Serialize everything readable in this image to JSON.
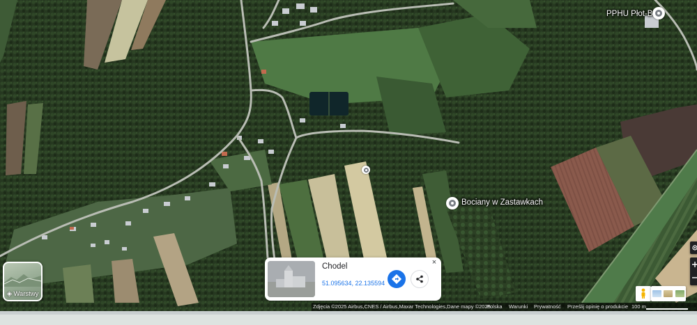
{
  "map": {
    "labels": {
      "business": "PPHU Płot-Bet",
      "poi": "Bociany w Zastawkach"
    }
  },
  "layers_button": {
    "label": "Warstwy",
    "icon": "layers-icon"
  },
  "info_card": {
    "title": "Chodel",
    "coordinates": "51.095634, 22.135594",
    "directions_icon": "directions-icon",
    "share_icon": "share-icon",
    "close_symbol": "×"
  },
  "controls": {
    "pegman_icon": "pegman-icon",
    "my_location_icon": "my-location-icon",
    "imagery_icons": [
      "imagery-photo-icon",
      "imagery-photo-icon",
      "imagery-photo-icon"
    ]
  },
  "attribution": {
    "copyright": "Zdjęcia ©2025 Airbus,CNES / Airbus,Maxar Technologies,Dane mapy ©2025",
    "country": "Polska",
    "terms": "Warunki",
    "privacy": "Prywatność",
    "feedback": "Prześlij opinię o produkcie",
    "scale": "100 m"
  },
  "colors": {
    "forest": "#25361f",
    "field_light": "#c8bf9a",
    "field_red": "#8a5a4c",
    "road": "#b9bdb4",
    "accent_blue": "#1a73e8"
  }
}
